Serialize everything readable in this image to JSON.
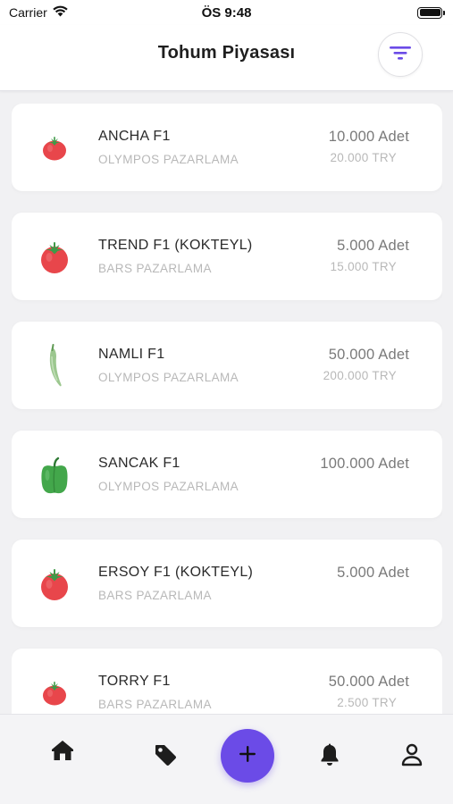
{
  "status_bar": {
    "carrier": "Carrier",
    "time": "ÖS 9:48"
  },
  "header": {
    "title": "Tohum Piyasası",
    "filter_icon": "filter-lines-icon"
  },
  "colors": {
    "accent": "#6b4be7",
    "tomato": "#e8464b",
    "stem": "#3f9a48",
    "green_pepper": "#43a74b",
    "chili": "#9cc78f"
  },
  "listings": [
    {
      "name": "ANCHA F1",
      "company": "OLYMPOS PAZARLAMA",
      "quantity": "10.000 Adet",
      "price": "20.000 TRY",
      "icon": "small-tomato-icon"
    },
    {
      "name": "TREND F1 (KOKTEYL)",
      "company": "BARS PAZARLAMA",
      "quantity": "5.000 Adet",
      "price": "15.000 TRY",
      "icon": "tomato-icon"
    },
    {
      "name": "NAMLI F1",
      "company": "OLYMPOS PAZARLAMA",
      "quantity": "50.000 Adet",
      "price": "200.000 TRY",
      "icon": "chili-pepper-icon"
    },
    {
      "name": "SANCAK F1",
      "company": "OLYMPOS PAZARLAMA",
      "quantity": "100.000 Adet",
      "price": "",
      "icon": "bell-pepper-icon"
    },
    {
      "name": "ERSOY F1 (KOKTEYL)",
      "company": "BARS PAZARLAMA",
      "quantity": "5.000 Adet",
      "price": "",
      "icon": "tomato-icon"
    },
    {
      "name": "TORRY F1",
      "company": "BARS PAZARLAMA",
      "quantity": "50.000 Adet",
      "price": "2.500 TRY",
      "icon": "small-tomato-icon"
    }
  ],
  "bottom_nav": {
    "items": [
      "home-icon",
      "tag-icon",
      "plus-icon",
      "bell-icon",
      "user-icon"
    ]
  }
}
